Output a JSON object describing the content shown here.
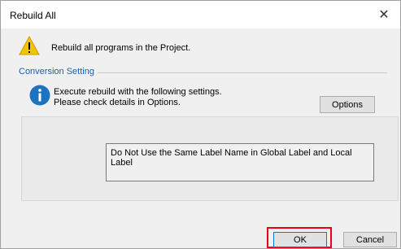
{
  "window": {
    "title": "Rebuild All",
    "close_glyph": "✕"
  },
  "warning": {
    "icon": "warning-icon",
    "message": "Rebuild all programs in the Project."
  },
  "conversion_setting": {
    "legend": "Conversion Setting",
    "info_icon": "info-icon",
    "info_line1": "Execute rebuild with the following settings.",
    "info_line2": "Please check details in Options.",
    "options_label": "Options",
    "setting_text": "Do Not Use the Same Label Name in Global Label and Local Label"
  },
  "buttons": {
    "ok_label": "OK",
    "cancel_label": "Cancel"
  },
  "colors": {
    "highlight": "#e8001c",
    "legend_blue": "#1a5fb4",
    "warning_yellow": "#f5c400",
    "info_blue": "#1e73be"
  }
}
